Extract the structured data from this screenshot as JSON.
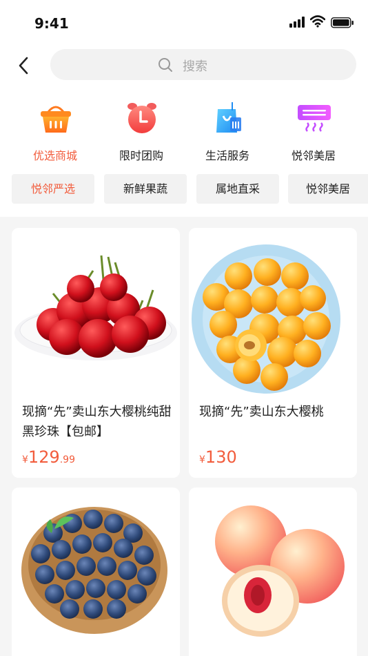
{
  "status_bar": {
    "time": "9:41"
  },
  "search": {
    "placeholder": "搜索"
  },
  "categories": [
    {
      "label": "优选商城",
      "icon": "basket-icon",
      "active": true
    },
    {
      "label": "限时团购",
      "icon": "alarm-clock-icon",
      "active": false
    },
    {
      "label": "生活服务",
      "icon": "shopping-bag-icon",
      "active": false
    },
    {
      "label": "悦邻美居",
      "icon": "air-conditioner-icon",
      "active": false
    }
  ],
  "chips": [
    "悦邻严选",
    "新鲜果蔬",
    "属地直采",
    "悦邻美居"
  ],
  "products": [
    {
      "title": "现摘“先”卖山东大樱桃纯甜黑珍珠【包邮】",
      "currency": "¥",
      "price_int": "129",
      "price_dec": ".99",
      "image": "cherries"
    },
    {
      "title": "现摘“先”卖山东大樱桃",
      "currency": "¥",
      "price_int": "130",
      "price_dec": "",
      "image": "apricots"
    },
    {
      "image": "blueberries"
    },
    {
      "image": "peaches"
    }
  ],
  "colors": {
    "accent": "#f25c3c",
    "chip_bg": "#f2f2f2",
    "page_bg": "#f5f5f5"
  }
}
